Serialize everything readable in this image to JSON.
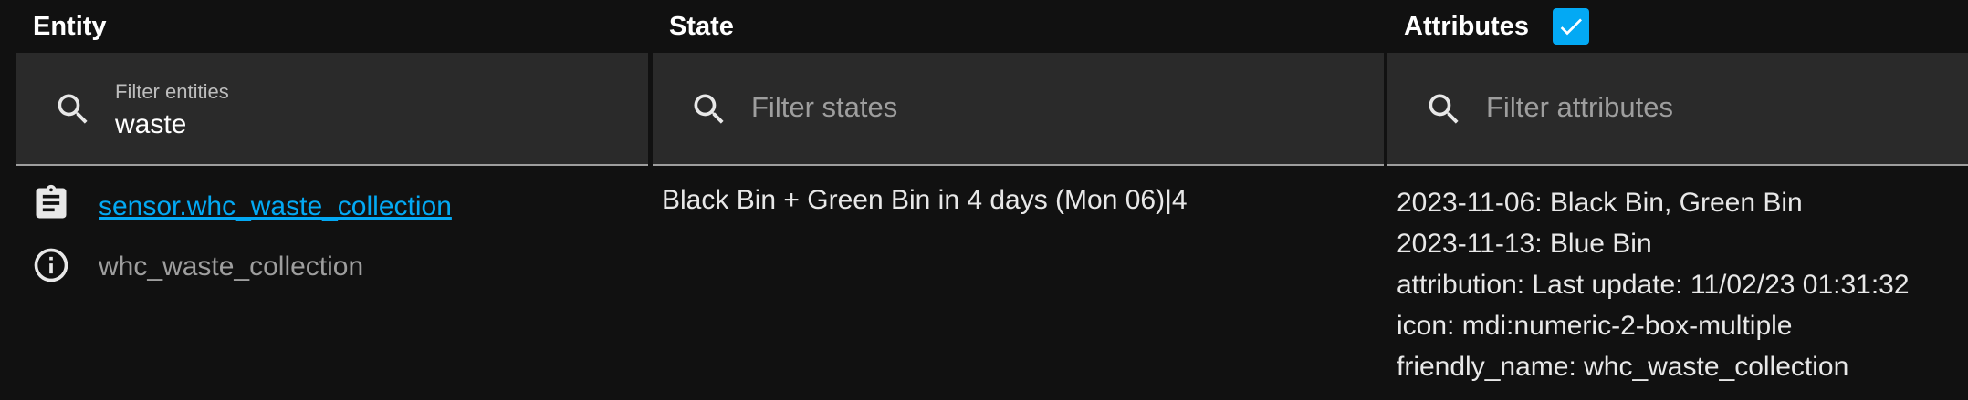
{
  "columns": {
    "entity_header": "Entity",
    "state_header": "State",
    "attributes_header": "Attributes"
  },
  "attributes_checkbox": {
    "checked": true
  },
  "filters": {
    "entities": {
      "label": "Filter entities",
      "value": "waste"
    },
    "states": {
      "placeholder": "Filter states"
    },
    "attributes": {
      "placeholder": "Filter attributes"
    }
  },
  "row": {
    "entity_link": "sensor.whc_waste_collection",
    "entity_id": "whc_waste_collection",
    "state": "Black Bin + Green Bin in 4 days (Mon 06)|4",
    "attributes": [
      "2023-11-06: Black Bin, Green Bin",
      "2023-11-13: Blue Bin",
      "attribution: Last update: 11/02/23 01:31:32",
      "icon: mdi:numeric-2-box-multiple",
      "friendly_name: whc_waste_collection"
    ]
  },
  "colors": {
    "background": "#111111",
    "filter_background": "#2a2a2a",
    "accent": "#03a9f4",
    "text": "#e1e1e1",
    "muted_text": "#9e9e9e"
  },
  "icons": {
    "search": "search-icon",
    "entity_more_info": "clipboard-text-icon",
    "entity_info": "information-outline-icon",
    "checkbox_check": "check-icon"
  }
}
